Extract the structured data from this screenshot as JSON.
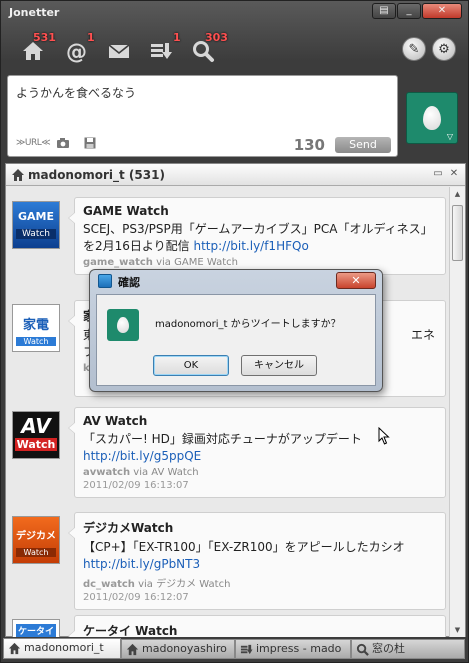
{
  "app": {
    "title": "Jonetter"
  },
  "window_buttons": {
    "menu": "▤",
    "minimize": "_",
    "close": "✕"
  },
  "toolbar": {
    "home_badge": "531",
    "mention_badge": "1",
    "message_badge": "",
    "list_badge": "1",
    "search_badge": "303"
  },
  "compose": {
    "text": "ようかんを食べるなう",
    "url_label": "≫URL≪",
    "char_count": "130",
    "send_label": "Send"
  },
  "timeline": {
    "title": "madonomori_t (531)",
    "tweets": [
      {
        "icon_label": "GAME Watch",
        "name": "GAME Watch",
        "text": "SCEJ、PS3/PSP用「ゲームアーカイブス」PCA「オルディネス」を2月16日より配信",
        "link": "http://bit.ly/f1HFQo",
        "user": "game_watch",
        "via": "via GAME Watch",
        "time": ""
      },
      {
        "icon_label": "家電 Watch",
        "name": "家",
        "text": "東",
        "text_right": "エネ",
        "text2": "フ",
        "user": "ka",
        "via": "",
        "time": ""
      },
      {
        "icon_label": "AV Watch",
        "name": "AV Watch",
        "text": "「スカパー! HD」録画対応チューナがアップデート",
        "link": "http://bit.ly/g5ppQE",
        "user": "avwatch",
        "via": "via AV Watch",
        "time": "2011/02/09 16:13:07"
      },
      {
        "icon_label": "デジカメ Watch",
        "name": "デジカメWatch",
        "text": "【CP+】「EX-TR100」「EX-ZR100」をアピールしたカシオ",
        "link": "http://bit.ly/gPbNT3",
        "user": "dc_watch",
        "via": "via デジカメ Watch",
        "time": "2011/02/09 16:12:07"
      },
      {
        "icon_label": "ケータイ",
        "name": "ケータイ Watch"
      }
    ]
  },
  "tabs": [
    {
      "label": "madonomori_t"
    },
    {
      "label": "madonoyashiro"
    },
    {
      "label": "impress - mado"
    },
    {
      "label": "窓の杜"
    }
  ],
  "dialog": {
    "title": "確認",
    "message": "madonomori_t からツイートしますか？",
    "ok_label": "OK",
    "cancel_label": "キャンセル",
    "close_label": "✕"
  },
  "colors": {
    "accent_green": "#1e8a6c",
    "badge_red": "#ff5050",
    "link_blue": "#1b5fb8"
  }
}
